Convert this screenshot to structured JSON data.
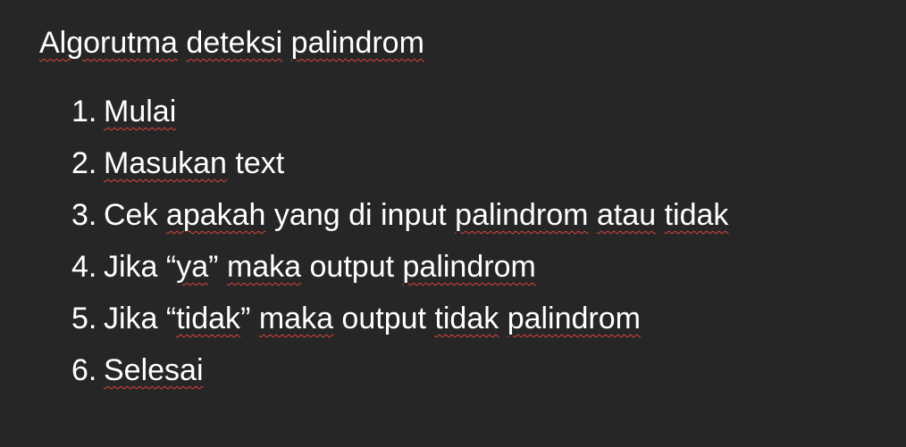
{
  "document": {
    "title_words": [
      "Algorutma",
      " ",
      "deteksi",
      " ",
      "palindrom"
    ],
    "steps": [
      {
        "number": "1.",
        "words": [
          "Mulai"
        ]
      },
      {
        "number": "2.",
        "words": [
          "Masukan",
          " text"
        ]
      },
      {
        "number": "3.",
        "words": [
          "Cek",
          " ",
          "apakah",
          " yang di input ",
          "palindrom",
          " ",
          "atau",
          " ",
          "tidak"
        ]
      },
      {
        "number": "4.",
        "words": [
          "Jika “",
          "ya",
          "” ",
          "maka",
          " output ",
          "palindrom"
        ]
      },
      {
        "number": "5.",
        "words": [
          "Jika “",
          "tidak",
          "” ",
          "maka",
          " output ",
          "tidak",
          " ",
          "palindrom"
        ]
      },
      {
        "number": "6.",
        "words": [
          "Selesai"
        ]
      }
    ]
  },
  "colors": {
    "background": "#262626",
    "text": "#ffffff",
    "spellcheck_underline": "#e0443e"
  }
}
